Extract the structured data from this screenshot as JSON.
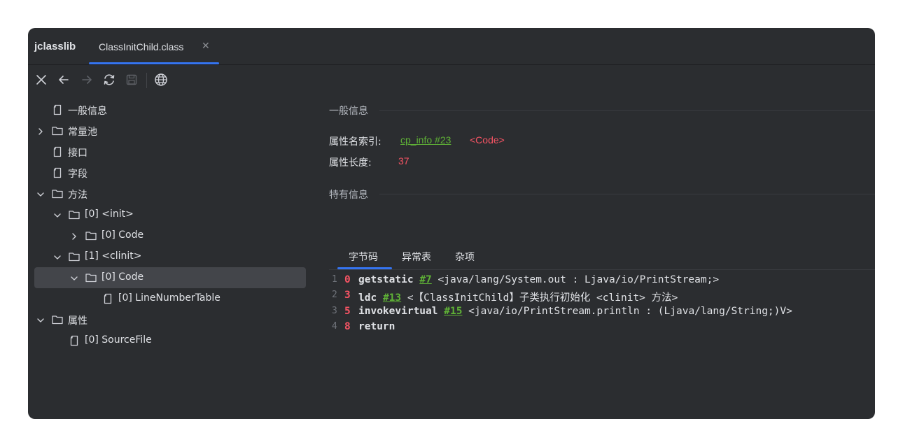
{
  "app": {
    "brand": "jclasslib"
  },
  "tabs": [
    {
      "label": "ClassInitChild.class",
      "close": "✕"
    }
  ],
  "toolbar": {
    "buttons": [
      "close-icon",
      "back-arrow-icon",
      "forward-arrow-icon",
      "refresh-icon",
      "save-icon",
      "globe-icon"
    ]
  },
  "tree": {
    "items": [
      {
        "label": "一般信息",
        "icon": "file-icon",
        "depth": 0
      },
      {
        "label": "常量池",
        "icon": "folder-icon",
        "depth": 0,
        "expand": "collapsed"
      },
      {
        "label": "接口",
        "icon": "file-icon",
        "depth": 0
      },
      {
        "label": "字段",
        "icon": "file-icon",
        "depth": 0
      },
      {
        "label": "方法",
        "icon": "folder-icon",
        "depth": 0,
        "expand": "expanded"
      },
      {
        "label": "[0] <init>",
        "icon": "folder-icon",
        "depth": 1,
        "expand": "expanded"
      },
      {
        "label": "[0] Code",
        "icon": "folder-icon",
        "depth": 2,
        "expand": "collapsed"
      },
      {
        "label": "[1] <clinit>",
        "icon": "folder-icon",
        "depth": 1,
        "expand": "expanded"
      },
      {
        "label": "[0] Code",
        "icon": "folder-icon",
        "depth": 2,
        "expand": "expanded",
        "selected": true
      },
      {
        "label": "[0] LineNumberTable",
        "icon": "file-icon",
        "depth": 3
      },
      {
        "label": "属性",
        "icon": "folder-icon",
        "depth": 0,
        "expand": "expanded"
      },
      {
        "label": "[0] SourceFile",
        "icon": "file-icon",
        "depth": 1
      }
    ]
  },
  "panel": {
    "general_title": "一般信息",
    "attr_name_index_label": "属性名索引:",
    "attr_name_index_link": "cp_info #23",
    "attr_name_index_value": "<Code>",
    "attr_length_label": "属性长度:",
    "attr_length_value": "37",
    "specific_title": "特有信息",
    "subtabs": [
      "字节码",
      "异常表",
      "杂项"
    ],
    "active_subtab": "字节码"
  },
  "bytecode": [
    {
      "line": "1",
      "offset": "0",
      "instr": "getstatic",
      "ref": "#7",
      "arg": "<java/lang/System.out : Ljava/io/PrintStream;>"
    },
    {
      "line": "2",
      "offset": "3",
      "instr": "ldc",
      "ref": "#13",
      "arg": "<【ClassInitChild】子类执行初始化 <clinit> 方法>"
    },
    {
      "line": "3",
      "offset": "5",
      "instr": "invokevirtual",
      "ref": "#15",
      "arg": "<java/io/PrintStream.println : (Ljava/lang/String;)V>"
    },
    {
      "line": "4",
      "offset": "8",
      "instr": "return",
      "ref": "",
      "arg": ""
    }
  ],
  "colors": {
    "background": "#2b2d30",
    "accent": "#3574f0",
    "link_green": "#5fb236",
    "value_red": "#f75464",
    "selection": "#43454a"
  }
}
